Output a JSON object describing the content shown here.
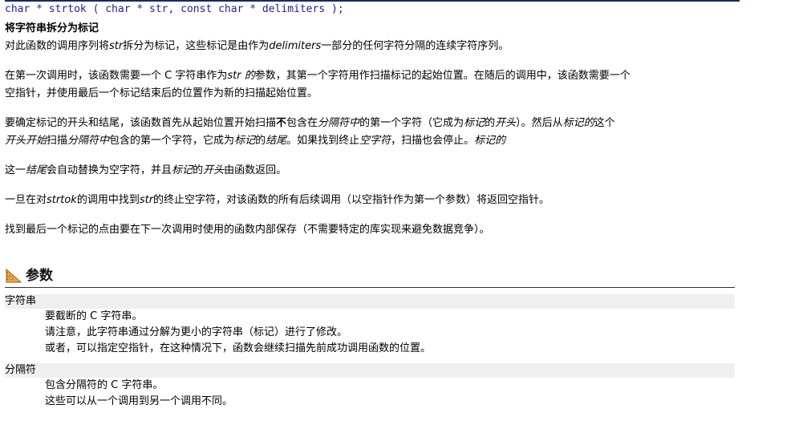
{
  "prototype": "char * strtok ( char * str, const char * delimiters );",
  "heading": "将字符串拆分为标记",
  "para1": {
    "a": "对此函数的调用序列将",
    "b": "str",
    "c": "拆分为标记，这些标记是由作为",
    "d": "delimiters",
    "e": "一部分的任何字符分隔的连续字符序列。"
  },
  "para2": {
    "a": "在第一次调用时，该函数需要一个 C 字符串作为",
    "b": "str 的",
    "c": "参数，其第一个字符用作扫描标记的起始位置。在随后的调用中，该函数需要一个",
    "d": "空指针，并使用最后一个标记结束后的位置作为新的扫描起始位置。"
  },
  "para3": {
    "a": "要确定标记的开头和结尾，该函数首先从起始位置开始扫描",
    "b": "不",
    "c": "包含在",
    "d": "分隔符中",
    "e": "的第一个字符（它成为",
    "f": "标记",
    "g": "的",
    "h": "开头",
    "i": "）。然后从",
    "j": "标记的",
    "k": "这个",
    "l": "开头开始",
    "m": "扫描",
    "n": "分隔符中",
    "o": "包含的第一个字符，它成为",
    "p": "标记",
    "q": "的",
    "r": "结尾",
    "s": "。如果找到终止",
    "t": "空字符",
    "u": "，扫描也会停止。",
    "v": "标记的"
  },
  "para4": {
    "a": "这一",
    "b": "结尾",
    "c": "会自动替换为空字符，并且",
    "d": "标记",
    "e": "的",
    "f": "开头",
    "g": "由函数返回。"
  },
  "para5": {
    "a": "一旦在对",
    "b": "strtok",
    "c": "的调用中找到",
    "d": "str",
    "e": "的终止空字符，对该函数的所有后续调用（以空指针作为第一个参数）将返回空指针。"
  },
  "para6": "找到最后一个标记的点由要在下一次调用时使用的函数内部保存（不需要特定的库实现来避免数据竞争）。",
  "section_title": "参数",
  "params": [
    {
      "name": "字符串",
      "lines": [
        "要截断的 C 字符串。",
        "请注意，此字符串通过分解为更小的字符串（标记）进行了修改。",
        "或者，可以指定空指针，在这种情况下，函数会继续扫描先前成功调用函数的位置。"
      ]
    },
    {
      "name": "分隔符",
      "lines": [
        "包含分隔符的 C 字符串。",
        "这些可以从一个调用到另一个调用不同。"
      ]
    }
  ],
  "colors": {
    "prototype": "#1f1f9a",
    "rule": "#1a2a5c",
    "param_bg": "#efefef"
  },
  "icons": {
    "section": "ruler-triangle-icon"
  }
}
